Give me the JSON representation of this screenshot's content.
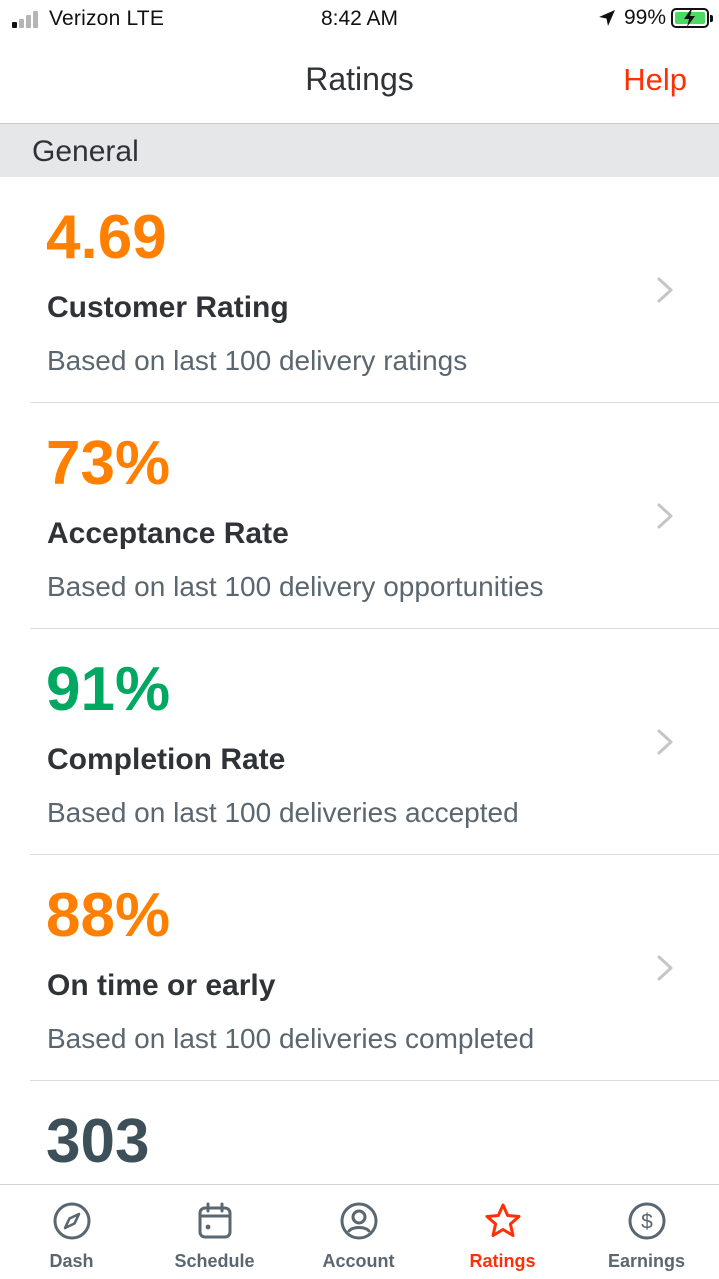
{
  "status_bar": {
    "carrier": "Verizon LTE",
    "time": "8:42 AM",
    "battery_percent": "99%",
    "signal_bars_active": 1,
    "signal_bars_total": 4,
    "battery_charging": true,
    "icons": [
      "location-arrow-icon",
      "battery-charging-icon",
      "signal-icon"
    ]
  },
  "nav": {
    "title": "Ratings",
    "help_label": "Help"
  },
  "section": {
    "title": "General"
  },
  "metrics": [
    {
      "value": "4.69",
      "label": "Customer Rating",
      "description": "Based on last 100 delivery ratings",
      "color": "#ff8000"
    },
    {
      "value": "73%",
      "label": "Acceptance Rate",
      "description": "Based on last 100 delivery opportunities",
      "color": "#ff8000"
    },
    {
      "value": "91%",
      "label": "Completion Rate",
      "description": "Based on last 100 deliveries accepted",
      "color": "#00a862"
    },
    {
      "value": "88%",
      "label": "On time or early",
      "description": "Based on last 100 deliveries completed",
      "color": "#ff8000"
    },
    {
      "value": "303",
      "label": "",
      "description": "",
      "color": "#3d4f59"
    }
  ],
  "tabs": [
    {
      "label": "Dash",
      "icon": "compass-icon",
      "active": false
    },
    {
      "label": "Schedule",
      "icon": "calendar-icon",
      "active": false
    },
    {
      "label": "Account",
      "icon": "user-circle-icon",
      "active": false
    },
    {
      "label": "Ratings",
      "icon": "star-icon",
      "active": true
    },
    {
      "label": "Earnings",
      "icon": "dollar-circle-icon",
      "active": false
    }
  ],
  "colors": {
    "accent": "#ff3008",
    "orange": "#ff8000",
    "green": "#00a862",
    "dark_slate": "#3d4f59",
    "text_primary": "#2f3338",
    "text_secondary": "#5b6770",
    "section_bg": "#e6e7e8"
  }
}
